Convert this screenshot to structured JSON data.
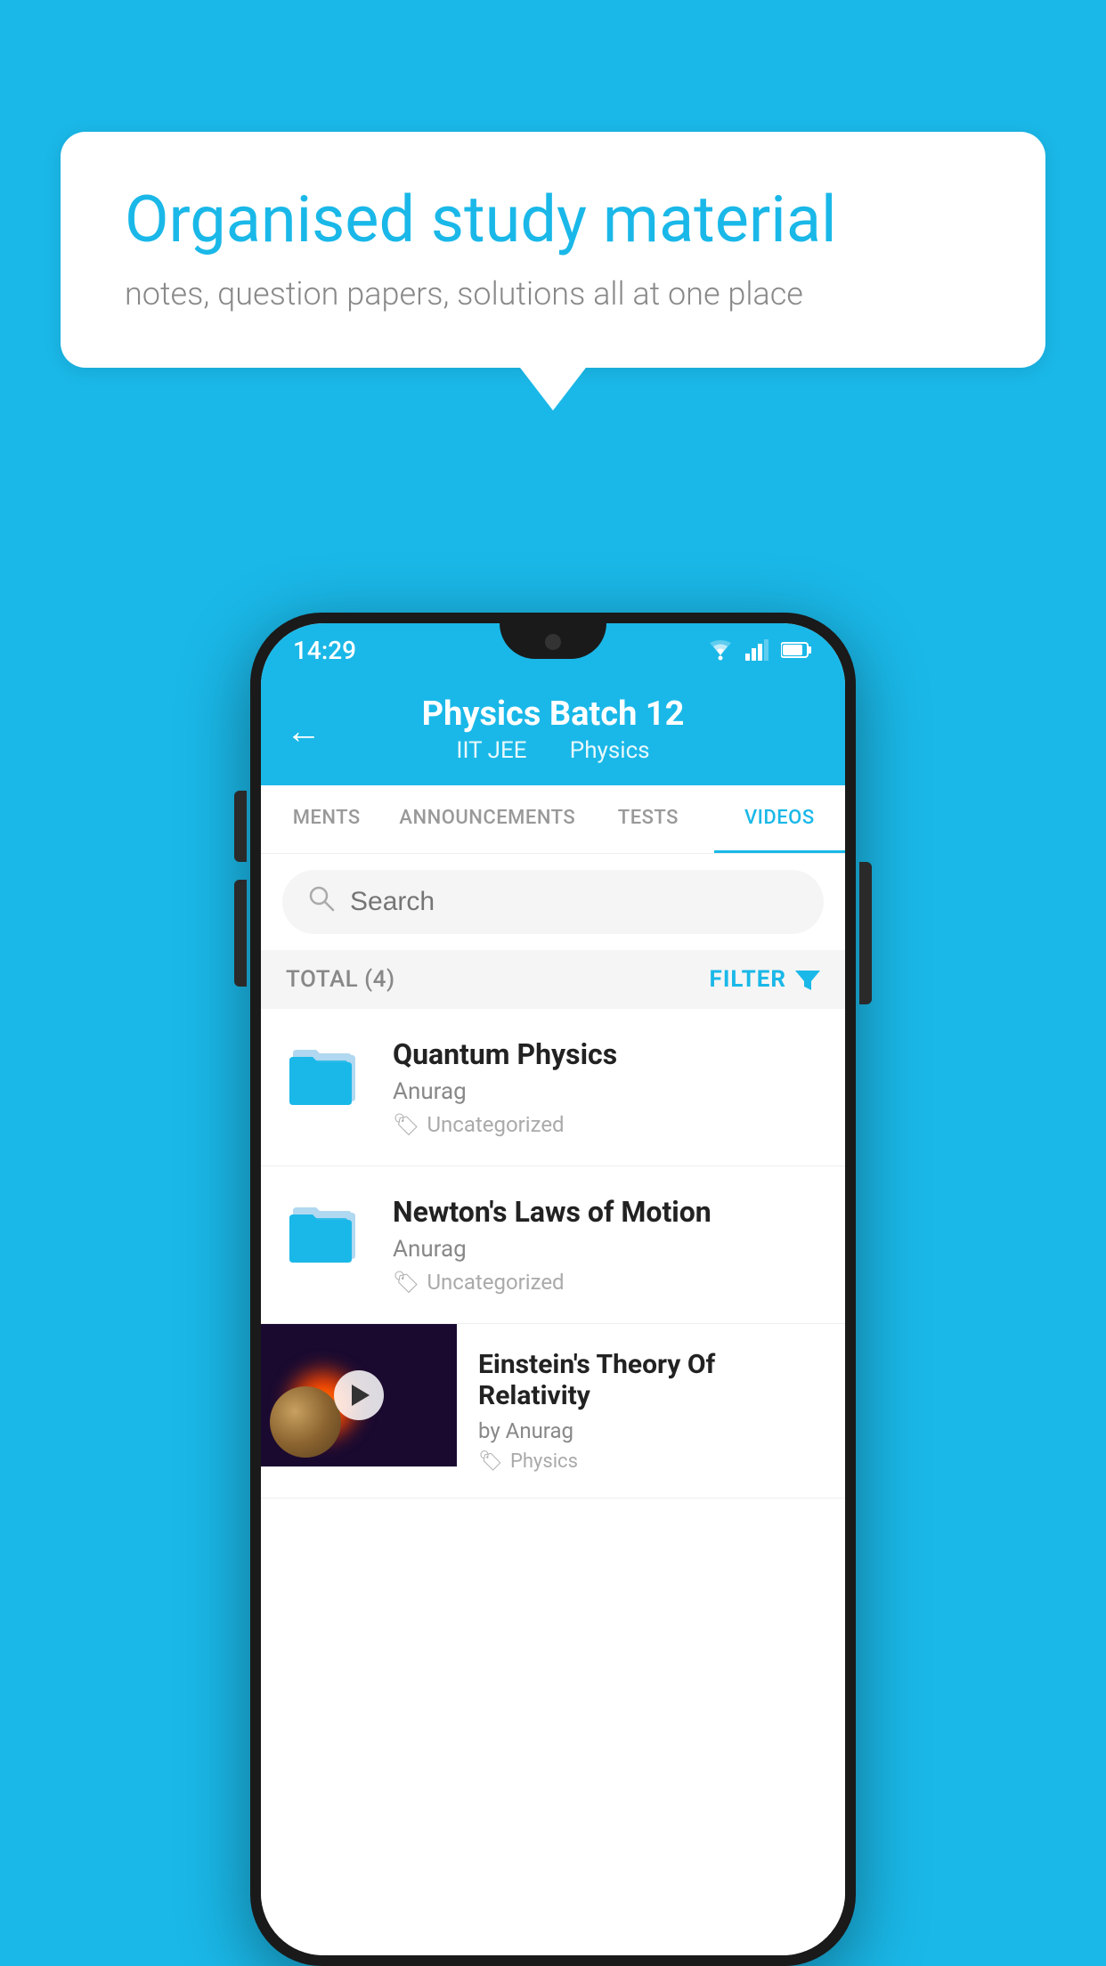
{
  "background_color": "#1ab8e8",
  "speech_bubble": {
    "title": "Organised study material",
    "subtitle": "notes, question papers, solutions all at one place"
  },
  "status_bar": {
    "time": "14:29",
    "wifi": "▾",
    "signal": "▾",
    "battery": "▮"
  },
  "header": {
    "title": "Physics Batch 12",
    "subtitle_part1": "IIT JEE",
    "subtitle_part2": "Physics",
    "back_label": "←"
  },
  "tabs": [
    {
      "label": "MENTS",
      "active": false
    },
    {
      "label": "ANNOUNCEMENTS",
      "active": false
    },
    {
      "label": "TESTS",
      "active": false
    },
    {
      "label": "VIDEOS",
      "active": true
    }
  ],
  "search": {
    "placeholder": "Search"
  },
  "filter": {
    "total_label": "TOTAL (4)",
    "filter_label": "FILTER"
  },
  "videos": [
    {
      "id": 1,
      "title": "Quantum Physics",
      "author": "Anurag",
      "tag": "Uncategorized",
      "has_thumbnail": false
    },
    {
      "id": 2,
      "title": "Newton's Laws of Motion",
      "author": "Anurag",
      "tag": "Uncategorized",
      "has_thumbnail": false
    },
    {
      "id": 3,
      "title": "Einstein's Theory Of Relativity",
      "author": "by Anurag",
      "tag": "Physics",
      "has_thumbnail": true
    }
  ]
}
